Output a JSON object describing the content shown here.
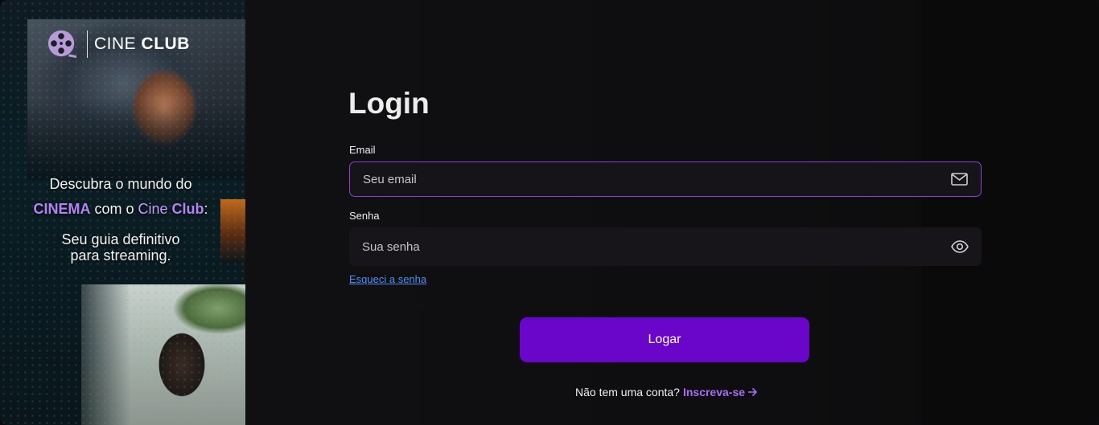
{
  "brand": {
    "name_light": "CINE",
    "name_bold": "CLUB",
    "accent_color": "#6a06c9",
    "highlight_color": "#b582f3"
  },
  "hero": {
    "line1": "Descubra o mundo do",
    "cinema_word": "CINEMA",
    "com_o": " com o ",
    "cine_word": "Cine",
    "club_word": "Club",
    "colon": ":",
    "sub_line1": "Seu guia definitivo",
    "sub_line2": "para streaming."
  },
  "form": {
    "title": "Login",
    "email_label": "Email",
    "email_placeholder": "Seu email",
    "email_icon": "mail-icon",
    "password_label": "Senha",
    "password_placeholder": "Sua senha",
    "password_icon": "eye-icon",
    "forgot_label": "Esqueci a senha",
    "submit_label": "Logar",
    "no_account_text": "Não tem uma conta?",
    "signup_label": "Inscreva-se",
    "signup_icon": "arrow-right-icon"
  }
}
